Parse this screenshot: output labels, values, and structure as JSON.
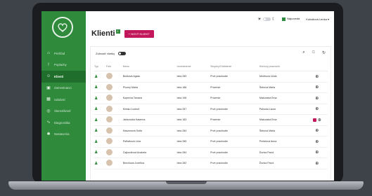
{
  "colors": {
    "brand": "#2f8a3c",
    "accent": "#c2185b"
  },
  "topbar": {
    "help_label": "Nápoveda",
    "user_name": "Kobaliová Lenka"
  },
  "sidebar": {
    "items": [
      {
        "label": "Prehľad",
        "icon": "home-icon"
      },
      {
        "label": "Poplachy",
        "icon": "alarm-icon"
      },
      {
        "label": "Klienti",
        "icon": "people-icon"
      },
      {
        "label": "Zamestnanci",
        "icon": "briefcase-icon"
      },
      {
        "label": "Udalosti",
        "icon": "calendar-icon"
      },
      {
        "label": "Starostlivosť",
        "icon": "care-icon"
      },
      {
        "label": "Diagnostika",
        "icon": "pulse-icon"
      },
      {
        "label": "Nastavenia",
        "icon": "gear-icon"
      }
    ]
  },
  "page": {
    "title": "Klienti",
    "title_badge": "1",
    "new_button": "+ NOVÝ KLIENT"
  },
  "filter": {
    "show_all_label": "Zobraziť všetky"
  },
  "table": {
    "headers": [
      "Typ",
      "Foto",
      "Meno",
      "Umiestnenie",
      "Skupiny/Oddelenie",
      "Klúčový pracovník"
    ],
    "rows": [
      {
        "name": "Bušková Agáta",
        "room": "Izba 289",
        "group": "Prvé poschodie",
        "worker": "Medňová Linda"
      },
      {
        "name": "Pčurný Mária",
        "room": "Izba 186",
        "group": "Prízemie",
        "worker": "Šebová Mária"
      },
      {
        "name": "Kopečná Tamara",
        "room": "Izba 196",
        "group": "Prízemie",
        "worker": "Makovská Ema"
      },
      {
        "name": "Klimko Ľudovít",
        "room": "Izba 287",
        "group": "Prvé poschodie",
        "worker": "Palocka Laura"
      },
      {
        "name": "Jankovská Katarína",
        "room": "Izba 183",
        "group": "Prízemie",
        "worker": "Makovská Ema"
      },
      {
        "name": "Haszenová Sofia",
        "room": "Izba 284",
        "group": "Prvé poschodie",
        "worker": "Šebová Mária"
      },
      {
        "name": "Paľkášová Livia",
        "room": "Izba 285",
        "group": "Prvé poschodie",
        "worker": "Pretelová Anna"
      },
      {
        "name": "Čajkovičová Anabela",
        "room": "Izba 284",
        "group": "Prvé poschodie",
        "worker": "Ďurica Pavol"
      },
      {
        "name": "Bencková Jozefína",
        "room": "Izba 282",
        "group": "Prvé poschodie",
        "worker": "Ďurica Pavol"
      }
    ]
  }
}
